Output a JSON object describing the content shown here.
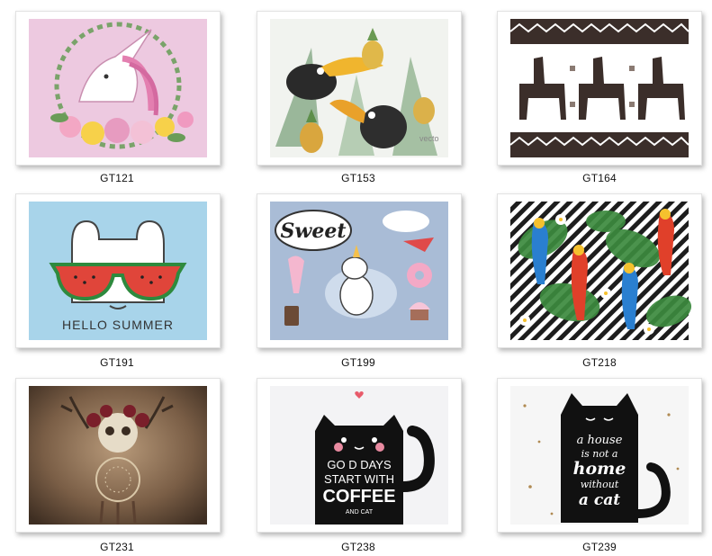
{
  "gallery": {
    "items": [
      {
        "code": "GT121",
        "subject": "unicorn with floral wreath"
      },
      {
        "code": "GT153",
        "subject": "toucans and pineapples",
        "watermark": "vecto"
      },
      {
        "code": "GT164",
        "subject": "tribal llama pattern"
      },
      {
        "code": "GT191",
        "subject": "cat with watermelon sunglasses",
        "caption": "HELLO SUMMER"
      },
      {
        "code": "GT199",
        "subject": "sweet unicorn with treats",
        "bubble": "Sweet"
      },
      {
        "code": "GT218",
        "subject": "parrots on tropical leaves"
      },
      {
        "code": "GT231",
        "subject": "skull dreamcatcher"
      },
      {
        "code": "GT238",
        "subject": "black cat coffee quote",
        "quote": [
          "GO D DAYS",
          "START WITH",
          "COFFEE"
        ],
        "sub": "AND CAT"
      },
      {
        "code": "GT239",
        "subject": "black cat house quote",
        "quote": [
          "a house",
          "is not a",
          "home",
          "without",
          "a cat"
        ]
      }
    ]
  },
  "colors": {
    "unicorn_bg": "#edc9e0",
    "summer_bg": "#a8d4ea",
    "sweet_bg": "#a9bcd6",
    "watermelon": "#e0453a",
    "leaf": "#3c8a3e"
  }
}
